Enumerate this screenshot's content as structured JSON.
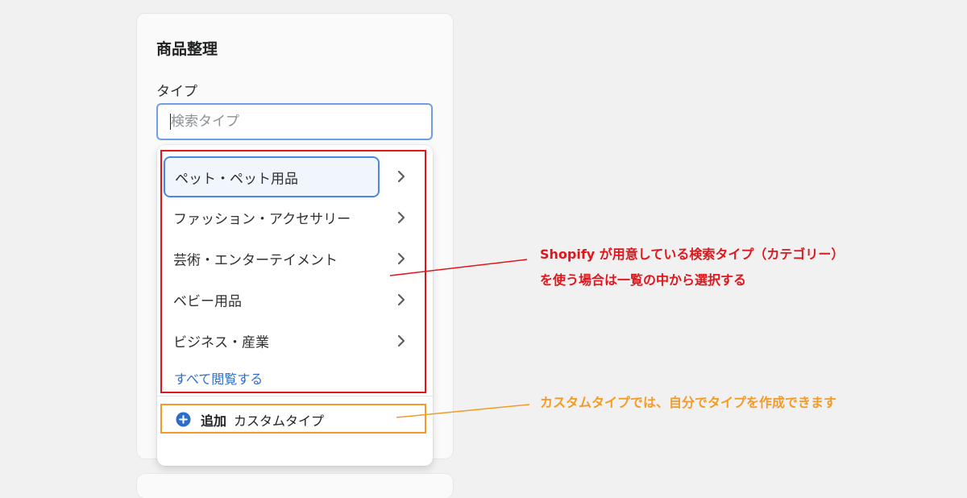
{
  "card": {
    "title": "商品整理"
  },
  "type_field": {
    "label": "タイプ",
    "placeholder": "検索タイプ"
  },
  "dropdown": {
    "items": [
      {
        "label": "ペット・ペット用品",
        "icon": "chevron-right-icon"
      },
      {
        "label": "ファッション・アクセサリー",
        "icon": "chevron-right-icon"
      },
      {
        "label": "芸術・エンターテイメント",
        "icon": "chevron-right-icon"
      },
      {
        "label": "ベビー用品",
        "icon": "chevron-right-icon"
      },
      {
        "label": "ビジネス・産業",
        "icon": "chevron-right-icon"
      }
    ],
    "view_all": "すべて閲覧する",
    "add_button": {
      "bold": "追加",
      "rest": "カスタムタイプ",
      "icon": "plus-circle-icon"
    }
  },
  "annotations": {
    "red_line1": "Shopify が用意している検索タイプ（カテゴリー）",
    "red_line2": "を使う場合は一覧の中から選択する",
    "orange": "カスタムタイプでは、自分でタイプを作成できます"
  },
  "colors": {
    "annotation_red": "#e0161c",
    "annotation_orange": "#f39b28",
    "focus_blue": "#4a86e8",
    "link_blue": "#2c6ecb"
  }
}
